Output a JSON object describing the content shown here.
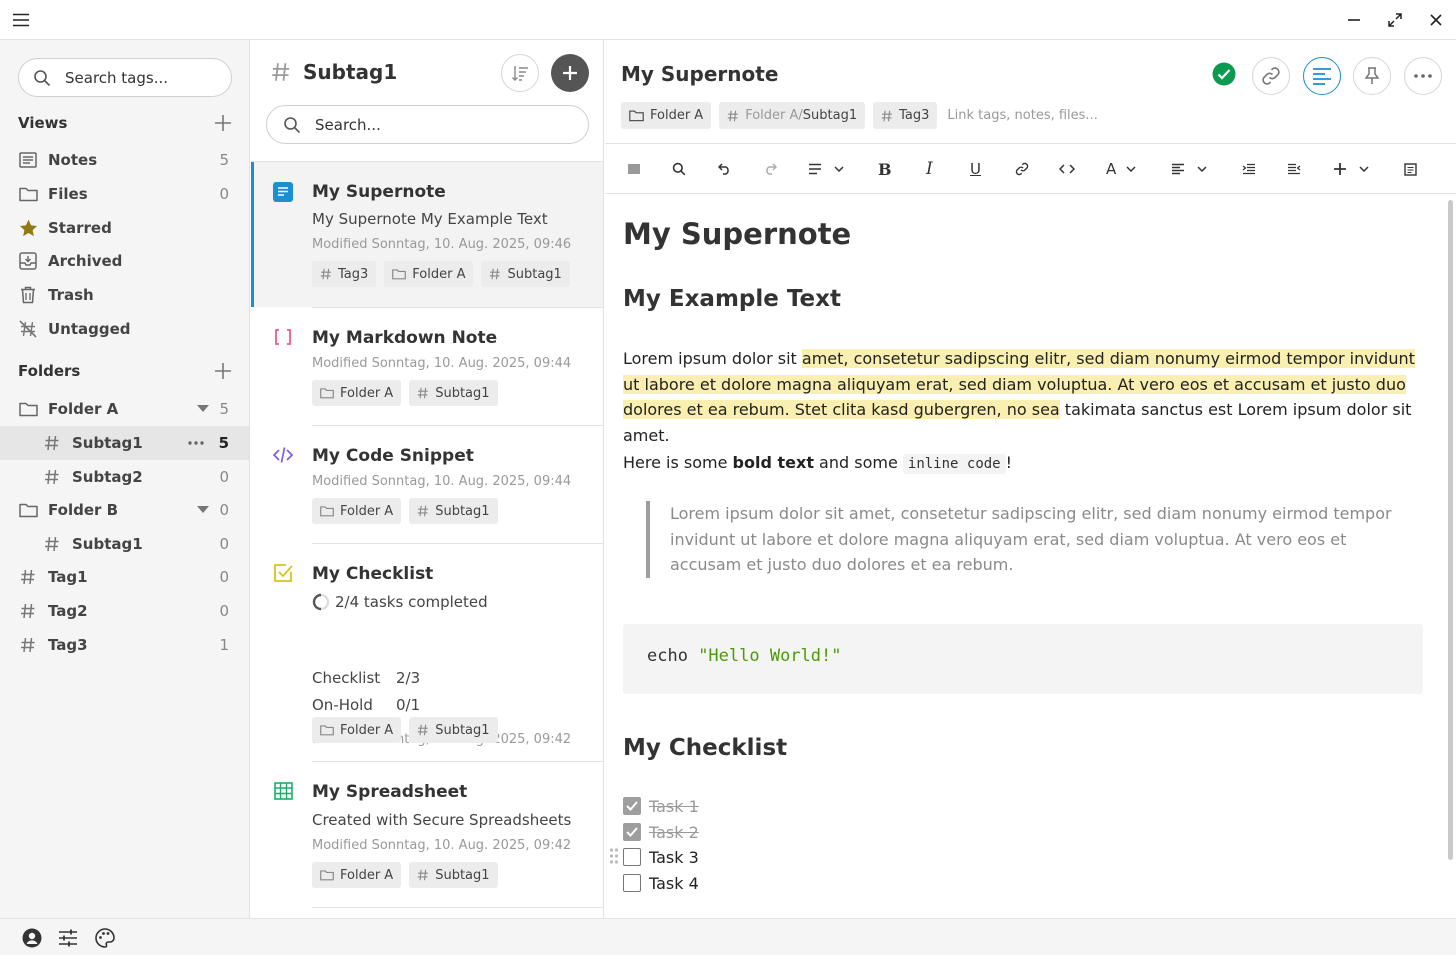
{
  "sidebar": {
    "search_placeholder": "Search tags...",
    "views_label": "Views",
    "folders_label": "Folders",
    "views": [
      {
        "label": "Notes",
        "count": "5",
        "icon": "notes-icon"
      },
      {
        "label": "Files",
        "count": "0",
        "icon": "folder-icon"
      },
      {
        "label": "Starred",
        "count": "",
        "icon": "star-icon"
      },
      {
        "label": "Archived",
        "count": "",
        "icon": "archive-icon"
      },
      {
        "label": "Trash",
        "count": "",
        "icon": "trash-icon"
      },
      {
        "label": "Untagged",
        "count": "",
        "icon": "untagged-icon"
      }
    ],
    "folders": [
      {
        "label": "Folder A",
        "count": "5"
      },
      {
        "label": "Subtag1",
        "count": "5"
      },
      {
        "label": "Subtag2",
        "count": "0"
      },
      {
        "label": "Folder B",
        "count": "0"
      },
      {
        "label": "Subtag1",
        "count": "0"
      },
      {
        "label": "Tag1",
        "count": "0"
      },
      {
        "label": "Tag2",
        "count": "0"
      },
      {
        "label": "Tag3",
        "count": "1"
      }
    ]
  },
  "notelist": {
    "title": "Subtag1",
    "search_placeholder": "Search...",
    "notes": [
      {
        "title": "My Supernote",
        "preview": "My Supernote My Example Text",
        "modified": "Modified Sonntag, 10. Aug. 2025, 09:46",
        "chips": [
          "Tag3",
          "Folder A",
          "Subtag1"
        ]
      },
      {
        "title": "My Markdown Note",
        "modified": "Modified Sonntag, 10. Aug. 2025, 09:44",
        "chips": [
          "Folder A",
          "Subtag1"
        ]
      },
      {
        "title": "My Code Snippet",
        "modified": "Modified Sonntag, 10. Aug. 2025, 09:44",
        "chips": [
          "Folder A",
          "Subtag1"
        ]
      },
      {
        "title": "My Checklist",
        "progress": "2/4 tasks completed",
        "groups": [
          {
            "name": "Checklist",
            "count": "2/3"
          },
          {
            "name": "On-Hold",
            "count": "0/1"
          }
        ],
        "modified": "Modified Sonntag, 10. Aug. 2025, 09:42",
        "chips": [
          "Folder A",
          "Subtag1"
        ]
      },
      {
        "title": "My Spreadsheet",
        "preview": "Created with Secure Spreadsheets",
        "modified": "Modified Sonntag, 10. Aug. 2025, 09:42",
        "chips": [
          "Folder A",
          "Subtag1"
        ]
      }
    ]
  },
  "editor": {
    "title": "My Supernote",
    "chips": {
      "folder": "Folder A",
      "tag_parent": "Folder A/",
      "tag_child": "Subtag1",
      "tag3": "Tag3"
    },
    "link_hint": "Link tags, notes, files...",
    "h1": "My Supernote",
    "h2a": "My Example Text",
    "para1_a": "Lorem ipsum dolor sit ",
    "para1_hl": "amet, consetetur sadipscing elitr, sed diam nonumy eirmod tempor invidunt ut labore et dolore magna aliquyam erat, sed diam voluptua. At vero eos et accusam et justo duo dolores et ea rebum. Stet clita kasd gubergren, no sea",
    "para1_b": " takimata sanctus est Lorem ipsum dolor sit amet.",
    "para2_a": "Here is some ",
    "para2_bold": "bold text",
    "para2_b": " and some ",
    "para2_code": "inline code",
    "para2_c": "!",
    "quote": "Lorem ipsum dolor sit amet, consetetur sadipscing elitr, sed diam nonumy eirmod tempor invidunt ut labore et dolore magna aliquyam erat, sed diam voluptua. At vero eos et accusam et justo duo dolores et ea rebum.",
    "code_cmd": "echo ",
    "code_str": "\"Hello World!\"",
    "h2b": "My Checklist",
    "tasks": [
      {
        "label": "Task 1",
        "done": true
      },
      {
        "label": "Task 2",
        "done": true
      },
      {
        "label": "Task 3",
        "done": false
      },
      {
        "label": "Task 4",
        "done": false
      }
    ]
  },
  "colors": {
    "accent": "#1a8fd6",
    "saved": "#0b9a4f",
    "star": "#8f7a12",
    "highlight": "#f9efb0"
  }
}
